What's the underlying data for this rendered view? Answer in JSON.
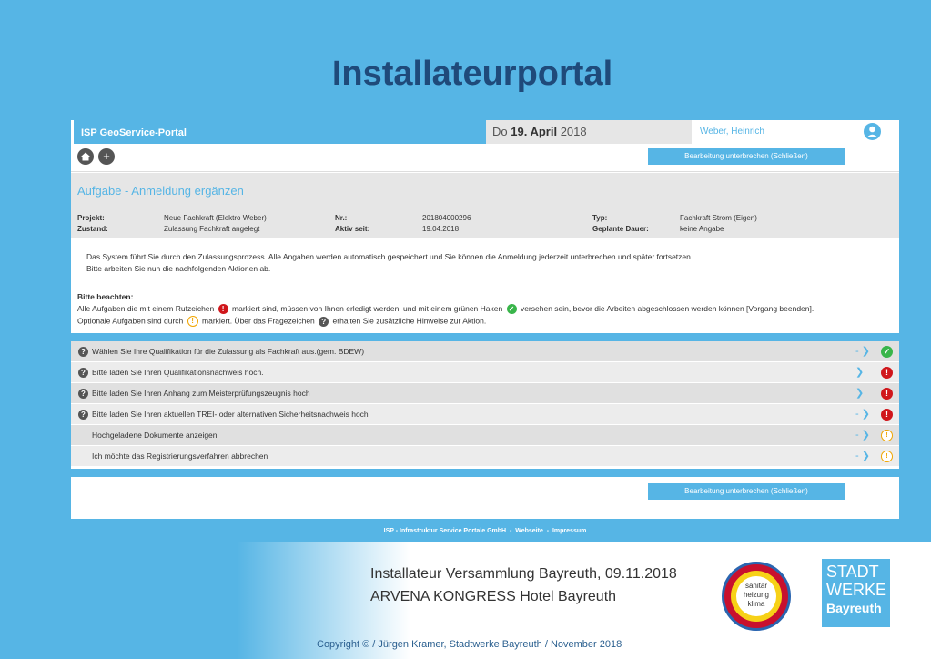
{
  "slide": {
    "title": "Installateurportal",
    "event_line1": "Installateur Versammlung Bayreuth, 09.11.2018",
    "event_line2": "ARVENA KONGRESS Hotel Bayreuth",
    "copyright": "Copyright © / Jürgen Kramer, Stadtwerke Bayreuth / November 2018",
    "logo_shk_lines": [
      "sanitär",
      "heizung",
      "klima"
    ],
    "logo_stadt_lines": [
      "STADT",
      "WERKE",
      "Bayreuth"
    ]
  },
  "portal": {
    "brand": "ISP GeoService-Portal",
    "date_prefix": "Do",
    "date_bold": "19. April",
    "date_year": "2018",
    "user_name": "Weber, Heinrich",
    "interrupt_button": "Bearbeitung unterbrechen (Schließen)",
    "task_title": "Aufgabe - Anmeldung ergänzen",
    "meta": {
      "projekt_label": "Projekt:",
      "projekt_value": "Neue Fachkraft (Elektro Weber)",
      "zustand_label": "Zustand:",
      "zustand_value": "Zulassung Fachkraft angelegt",
      "nr_label": "Nr.:",
      "nr_value": "201804000296",
      "aktiv_label": "Aktiv seit:",
      "aktiv_value": "19.04.2018",
      "typ_label": "Typ:",
      "typ_value": "Fachkraft Strom (Eigen)",
      "dauer_label": "Geplante Dauer:",
      "dauer_value": "keine Angabe"
    },
    "intro_line1": "Das System führt Sie durch den Zulassungsprozess. Alle Angaben werden automatisch gespeichert und Sie können die Anmeldung jederzeit unterbrechen und später fortsetzen.",
    "intro_line2": "Bitte arbeiten Sie nun die nachfolgenden Aktionen ab.",
    "note_title": "Bitte beachten:",
    "note1_a": "Alle Aufgaben die mit einem Rufzeichen",
    "note1_b": "markiert sind, müssen von Ihnen erledigt werden, und mit einem grünen Haken",
    "note1_c": "versehen sein, bevor die Arbeiten abgeschlossen werden können [Vorgang beenden].",
    "note2_a": "Optionale Aufgaben sind durch",
    "note2_b": "markiert. Über das Fragezeichen",
    "note2_c": "erhalten Sie zusätzliche Hinweise zur Aktion.",
    "tasks": [
      {
        "label": "Wählen Sie Ihre Qualifikation für die Zulassung als Fachkraft aus.(gem. BDEW)",
        "arrow": "- ❯",
        "status": "green"
      },
      {
        "label": "Bitte laden Sie Ihren Qualifikationsnachweis hoch.",
        "arrow": "❯",
        "status": "red"
      },
      {
        "label": "Bitte laden Sie Ihren Anhang zum Meisterprüfungszeugnis hoch",
        "arrow": "❯",
        "status": "red"
      },
      {
        "label": "Bitte laden Sie Ihren aktuellen TREI- oder alternativen Sicherheitsnachweis hoch",
        "arrow": "- ❯",
        "status": "red"
      },
      {
        "label": "Hochgeladene Dokumente anzeigen",
        "arrow": "- ❯",
        "status": "orange"
      },
      {
        "label": "Ich möchte das Registrierungsverfahren abbrechen",
        "arrow": "- ❯",
        "status": "orange"
      }
    ],
    "footer_company": "ISP - Infrastruktur Service Portale GmbH",
    "footer_sep": "-",
    "footer_webseite": "Webseite",
    "footer_impressum": "Impressum"
  },
  "colors": {
    "accent": "#56b5e5",
    "title": "#1f4a7a",
    "required": "#d0161b",
    "done": "#39b54a",
    "optional": "#f0a500"
  },
  "icons": {
    "home": "home-icon",
    "add": "plus-icon",
    "user": "user-avatar-icon",
    "help": "question-icon"
  }
}
